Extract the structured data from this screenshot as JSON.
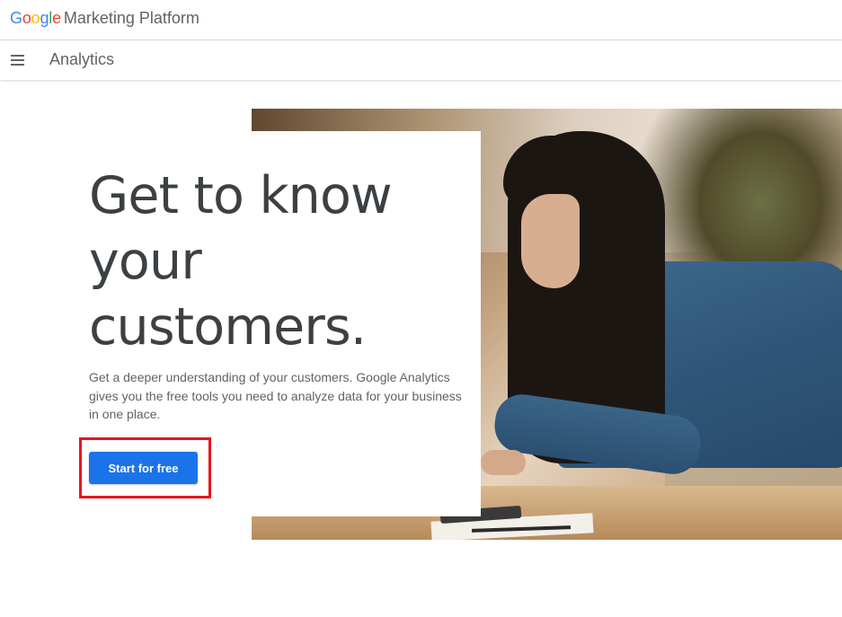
{
  "header": {
    "brand_logo_text": "Google",
    "brand_product": "Marketing Platform"
  },
  "subnav": {
    "menu_icon": "hamburger-menu-icon",
    "title": "Analytics"
  },
  "hero": {
    "headline_lines": [
      "Get to know",
      "your",
      "customers."
    ],
    "description": "Get a deeper understanding of your customers. Google Analytics gives you the free tools you need to analyze data for your business in one place.",
    "cta_label": "Start for free",
    "cta_color": "#1a73e8",
    "highlight_color": "#e8151e",
    "photo_subject": "woman-at-table-photo"
  },
  "colors": {
    "google_blue": "#4285F4",
    "google_red": "#EA4335",
    "google_yellow": "#FBBC05",
    "google_green": "#34A853",
    "text_dark": "#3c4043",
    "text_muted": "#5f6368"
  }
}
